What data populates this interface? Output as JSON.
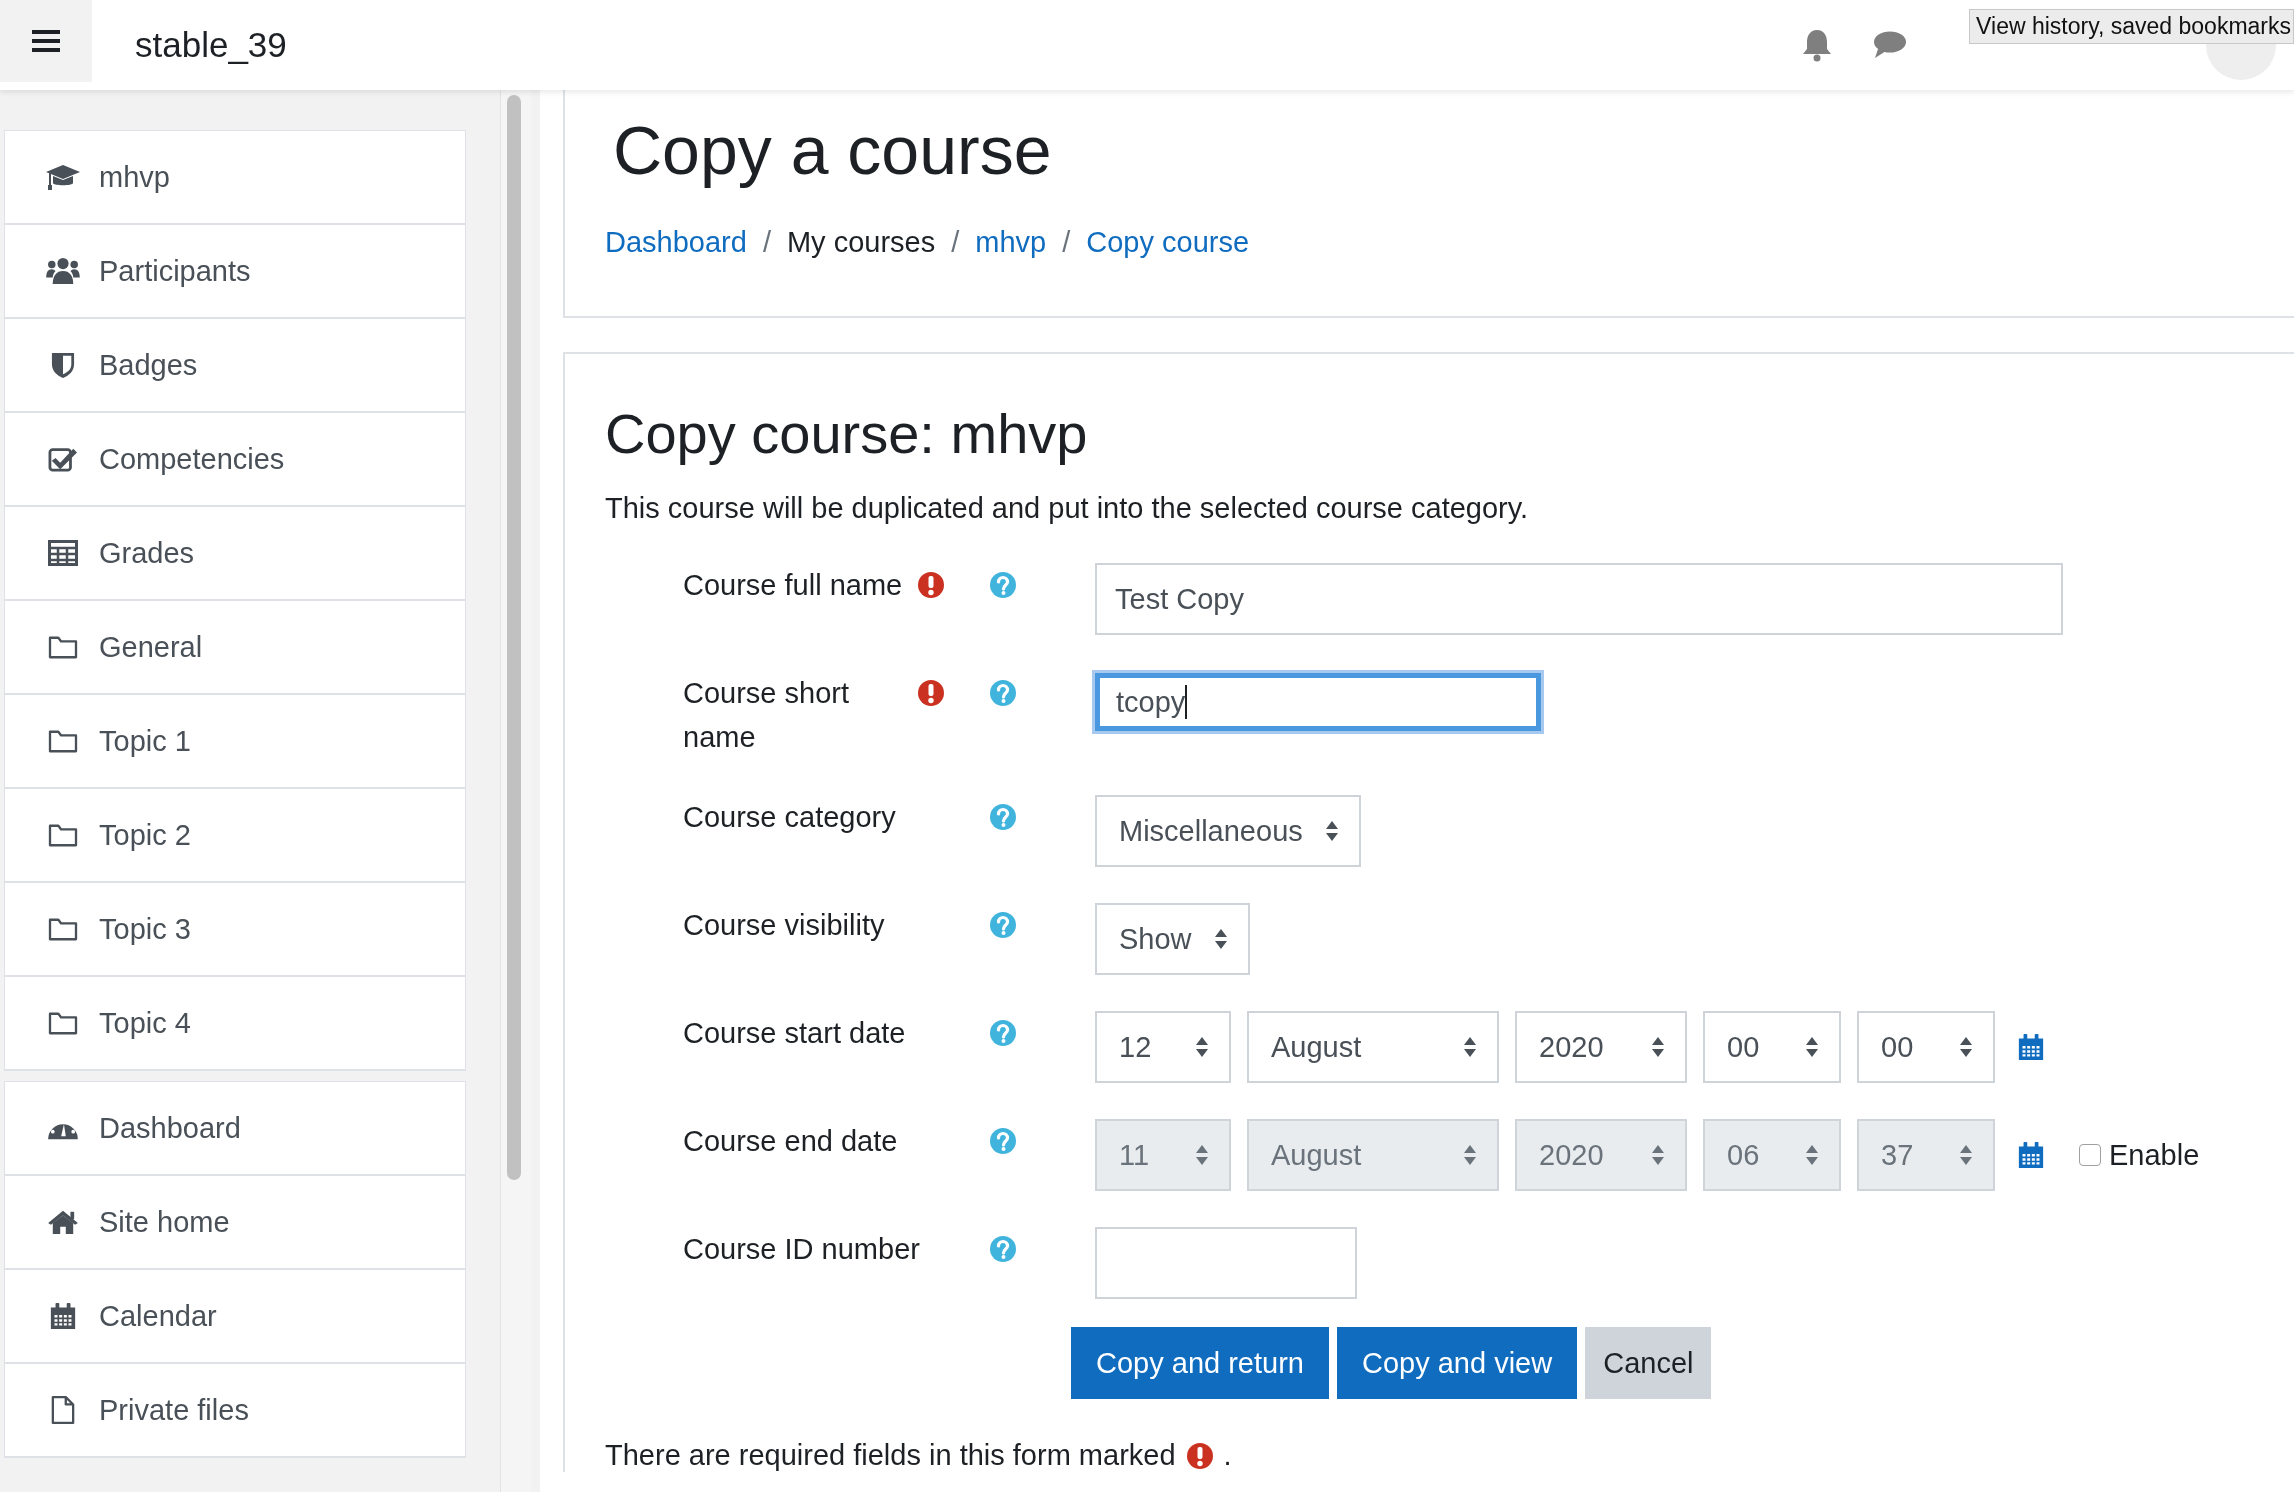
{
  "header": {
    "site_name": "stable_39",
    "tooltip": "View history, saved bookmarks"
  },
  "sidebar": {
    "sections": [
      {
        "items": [
          {
            "label": "mhvp",
            "kind": "course"
          },
          {
            "label": "Participants",
            "kind": "users"
          },
          {
            "label": "Badges",
            "kind": "shield"
          },
          {
            "label": "Competencies",
            "kind": "check"
          },
          {
            "label": "Grades",
            "kind": "table"
          },
          {
            "label": "General",
            "kind": "folder"
          },
          {
            "label": "Topic 1",
            "kind": "folder"
          },
          {
            "label": "Topic 2",
            "kind": "folder"
          },
          {
            "label": "Topic 3",
            "kind": "folder"
          },
          {
            "label": "Topic 4",
            "kind": "folder"
          }
        ]
      },
      {
        "items": [
          {
            "label": "Dashboard",
            "kind": "gauge"
          },
          {
            "label": "Site home",
            "kind": "home"
          },
          {
            "label": "Calendar",
            "kind": "calendar"
          },
          {
            "label": "Private files",
            "kind": "file"
          }
        ]
      }
    ]
  },
  "page": {
    "title": "Copy a course",
    "breadcrumb": [
      {
        "label": "Dashboard",
        "kind": "link"
      },
      {
        "label": "/",
        "kind": "separator"
      },
      {
        "label": "My courses",
        "kind": "text"
      },
      {
        "label": "/",
        "kind": "separator"
      },
      {
        "label": "mhvp",
        "kind": "link"
      },
      {
        "label": "/",
        "kind": "separator"
      },
      {
        "label": "Copy course",
        "kind": "link"
      }
    ]
  },
  "form": {
    "title": "Copy course: mhvp",
    "description": "This course will be duplicated and put into the selected course category.",
    "fields": [
      {
        "label": "Course full name",
        "kind": "text",
        "required": true,
        "focused": false,
        "value": "Test Copy"
      },
      {
        "label": "Course short name",
        "kind": "text",
        "required": true,
        "focused": true,
        "value": "tcopy"
      },
      {
        "label": "Course category",
        "kind": "select",
        "value": "Miscellaneous"
      },
      {
        "label": "Course visibility",
        "kind": "select",
        "value": "Show"
      },
      {
        "label": "Course start date",
        "kind": "date",
        "disabled": false,
        "parts": [
          "12",
          "August",
          "2020",
          "00",
          "00"
        ]
      },
      {
        "label": "Course end date",
        "kind": "date",
        "disabled": true,
        "parts": [
          "11",
          "August",
          "2020",
          "06",
          "37"
        ],
        "enable": {
          "label": "Enable",
          "checked": false
        }
      },
      {
        "label": "Course ID number",
        "kind": "text",
        "required": false,
        "focused": false
      }
    ],
    "buttons": [
      {
        "label": "Copy and return",
        "kind": "primary"
      },
      {
        "label": "Copy and view",
        "kind": "primary"
      },
      {
        "label": "Cancel",
        "kind": "secondary"
      }
    ],
    "note": {
      "text": "There are required fields in this form marked",
      "end": "."
    }
  }
}
